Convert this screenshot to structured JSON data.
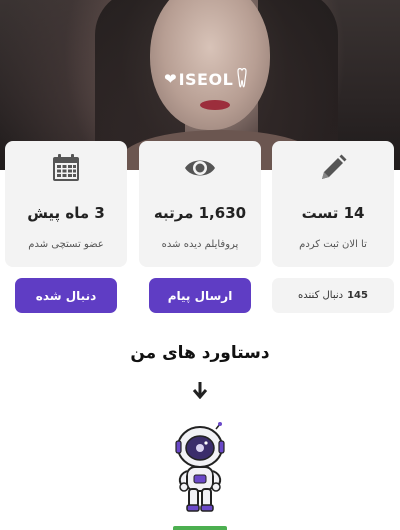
{
  "brand": {
    "logo_text": "ISEOL"
  },
  "stats": [
    {
      "icon": "calendar-icon",
      "value": "3 ماه پیش",
      "caption": "عضو تستچی شدم"
    },
    {
      "icon": "eye-icon",
      "value": "1,630 مرتبه",
      "caption": "پروفایلم دیده شده"
    },
    {
      "icon": "pencil-icon",
      "value": "14 تست",
      "caption": "تا الان ثبت کردم"
    }
  ],
  "actions": {
    "follow_label": "دنبال شده",
    "message_label": "ارسال پیام",
    "followers_count": "145",
    "followers_label": "دنبال کننده"
  },
  "achievements": {
    "title": "دستاورد های من"
  },
  "colors": {
    "accent": "#5f3dc4",
    "card_bg": "#f3f3f3",
    "badge_green": "#4caf50"
  }
}
